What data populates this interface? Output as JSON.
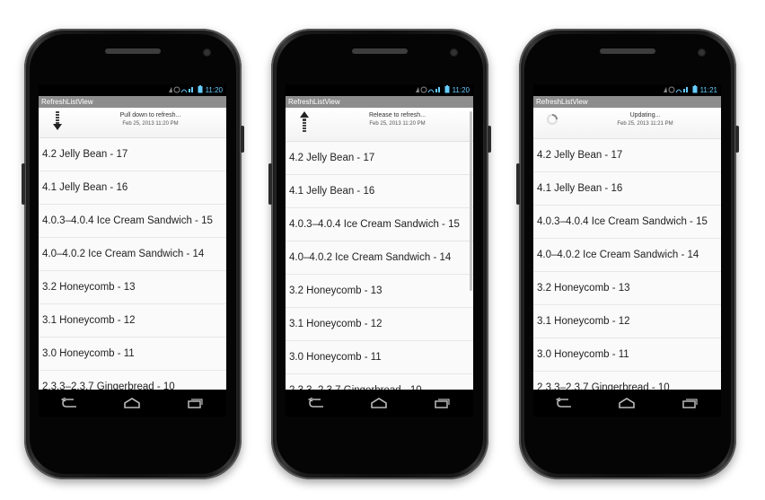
{
  "phones": [
    {
      "status_time": "11:20",
      "app_title": "RefreshListView",
      "header_main": "Pull down to refresh...",
      "header_sub": "Feb 25, 2013 11:20 PM",
      "state_icon": "arrow-down-icon"
    },
    {
      "status_time": "11:20",
      "app_title": "RefreshListView",
      "header_main": "Release to refresh...",
      "header_sub": "Feb 25, 2013 11:20 PM",
      "state_icon": "arrow-up-icon"
    },
    {
      "status_time": "11:21",
      "app_title": "RefreshListView",
      "header_main": "Updating...",
      "header_sub": "Feb 25, 2013 11:21 PM",
      "state_icon": "spinner-icon"
    }
  ],
  "list_items": [
    "4.2 Jelly Bean - 17",
    "4.1 Jelly Bean - 16",
    "4.0.3–4.0.4 Ice Cream Sandwich - 15",
    "4.0–4.0.2 Ice Cream Sandwich - 14",
    "3.2 Honeycomb - 13",
    "3.1 Honeycomb - 12",
    "3.0 Honeycomb - 11",
    "2.3.3–2.3.7 Gingerbread - 10"
  ],
  "nav_icons": [
    "back-icon",
    "home-icon",
    "recent-apps-icon"
  ]
}
